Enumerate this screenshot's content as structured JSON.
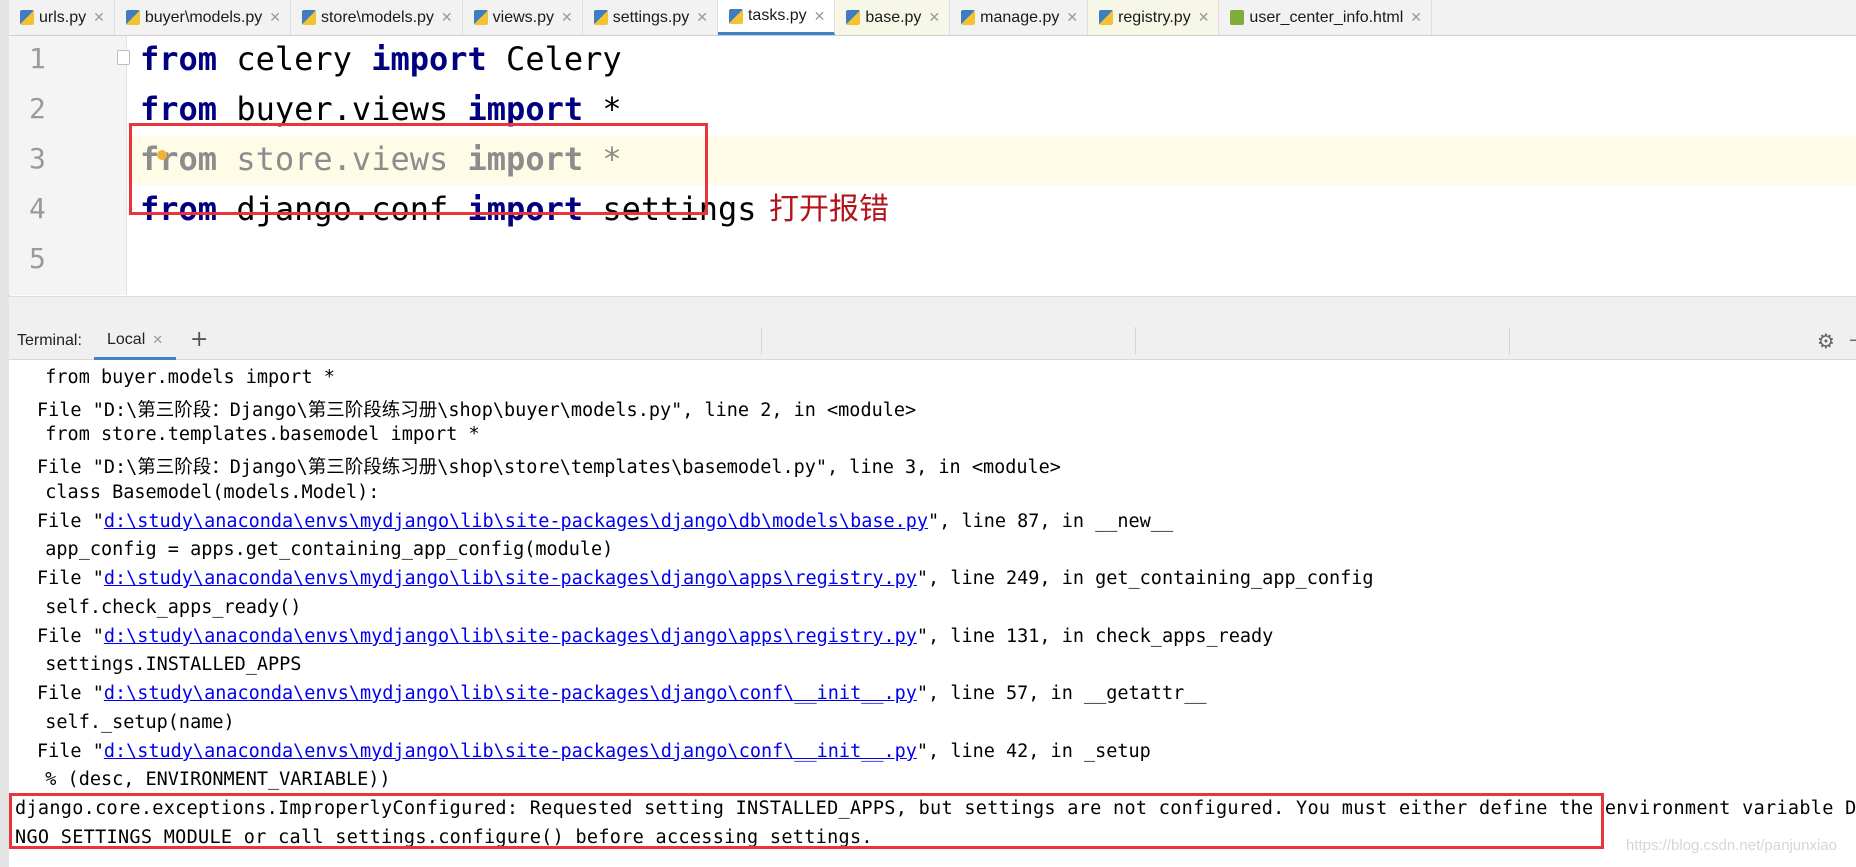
{
  "tabs": [
    {
      "label": "urls.py",
      "icon": "python-file-icon"
    },
    {
      "label": "buyer\\models.py",
      "icon": "python-file-icon"
    },
    {
      "label": "store\\models.py",
      "icon": "python-file-icon"
    },
    {
      "label": "views.py",
      "icon": "python-file-icon"
    },
    {
      "label": "settings.py",
      "icon": "python-file-icon"
    },
    {
      "label": "tasks.py",
      "icon": "python-file-icon",
      "active": true
    },
    {
      "label": "base.py",
      "icon": "python-file-icon"
    },
    {
      "label": "manage.py",
      "icon": "python-file-icon"
    },
    {
      "label": "registry.py",
      "icon": "python-file-icon"
    },
    {
      "label": "user_center_info.html",
      "icon": "html-file-icon"
    }
  ],
  "editor": {
    "line_numbers": [
      "1",
      "2",
      "3",
      "4",
      "5"
    ],
    "lines": [
      {
        "kw1": "from",
        "mid": " celery ",
        "kw2": "import",
        "end": " Celery"
      },
      {
        "kw1": "from",
        "mid": " buyer.views ",
        "kw2": "import",
        "end": " *"
      },
      {
        "kw1": "from",
        "mid": " store.views ",
        "kw2": "import",
        "end": " *"
      },
      {
        "kw1": "from",
        "mid": " django.conf ",
        "kw2": "import",
        "end": " settings"
      }
    ],
    "annotation": "打开报错"
  },
  "terminal": {
    "title": "Terminal:",
    "tab_label": "Local",
    "lines": {
      "l0": "  from buyer.models import *",
      "l1": "File \"D:\\第三阶段：Django\\第三阶段练习册\\shop\\buyer\\models.py\", line 2, in <module>",
      "l2": "  from store.templates.basemodel import *",
      "l3": "File \"D:\\第三阶段：Django\\第三阶段练习册\\shop\\store\\templates\\basemodel.py\", line 3, in <module>",
      "l4": "  class Basemodel(models.Model):",
      "l5a": "File \"",
      "l5b": "d:\\study\\anaconda\\envs\\mydjango\\lib\\site-packages\\django\\db\\models\\base.py",
      "l5c": "\", line 87, in __new__",
      "l6": "  app_config = apps.get_containing_app_config(module)",
      "l7a": "File \"",
      "l7b": "d:\\study\\anaconda\\envs\\mydjango\\lib\\site-packages\\django\\apps\\registry.py",
      "l7c": "\", line 249, in get_containing_app_config",
      "l8": "  self.check_apps_ready()",
      "l9a": "File \"",
      "l9b": "d:\\study\\anaconda\\envs\\mydjango\\lib\\site-packages\\django\\apps\\registry.py",
      "l9c": "\", line 131, in check_apps_ready",
      "l10": "  settings.INSTALLED_APPS",
      "l11a": "File \"",
      "l11b": "d:\\study\\anaconda\\envs\\mydjango\\lib\\site-packages\\django\\conf\\__init__.py",
      "l11c": "\", line 57, in __getattr__",
      "l12": "  self._setup(name)",
      "l13a": "File \"",
      "l13b": "d:\\study\\anaconda\\envs\\mydjango\\lib\\site-packages\\django\\conf\\__init__.py",
      "l13c": "\", line 42, in _setup",
      "l14": "  % (desc, ENVIRONMENT_VARIABLE))",
      "l15": "django.core.exceptions.ImproperlyConfigured: Requested setting INSTALLED_APPS, but settings are not configured. You must either define the environment variable DJA",
      "l16": "NGO_SETTINGS_MODULE or call settings.configure() before accessing settings."
    },
    "watermark": "https://blog.csdn.net/panjunxiao"
  },
  "colors": {
    "keyword": "#000080",
    "link": "#0000ee",
    "highlight_box": "#e8353c",
    "annotation": "#b3131b",
    "active_tab_underline": "#4083c9"
  }
}
